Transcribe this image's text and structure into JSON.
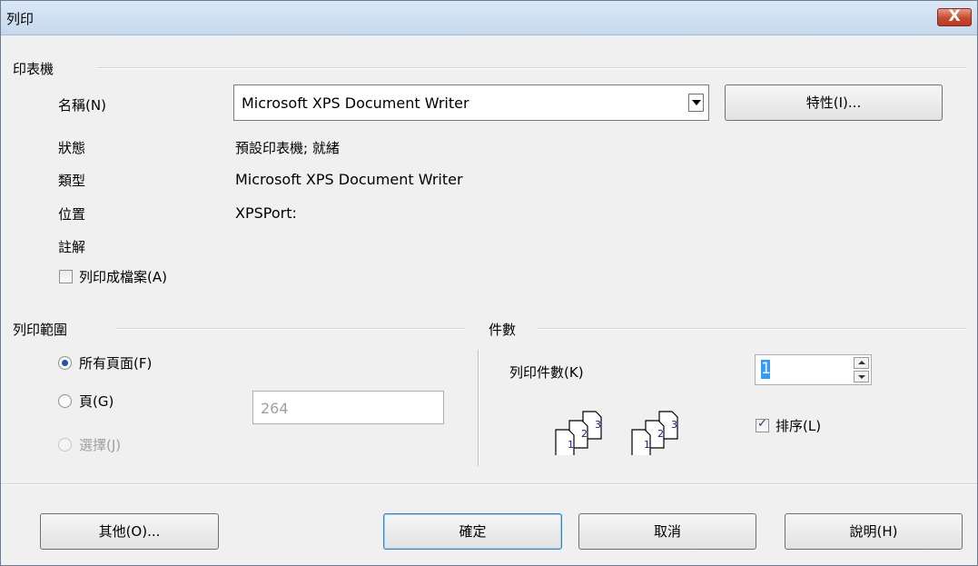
{
  "window": {
    "title": "列印",
    "close_label": "X"
  },
  "printer": {
    "group_label": "印表機",
    "name_label": "名稱(N)",
    "name_value": "Microsoft XPS Document Writer",
    "properties_button": "特性(I)...",
    "status_label": "狀態",
    "status_value": "預設印表機; 就緒",
    "type_label": "類型",
    "type_value": "Microsoft XPS Document Writer",
    "location_label": "位置",
    "location_value": "XPSPort:",
    "comment_label": "註解",
    "print_to_file_label": "列印成檔案(A)",
    "print_to_file_checked": false
  },
  "range": {
    "group_label": "列印範圍",
    "all_pages_label": "所有頁面(F)",
    "pages_label": "頁(G)",
    "pages_value": "264",
    "selection_label": "選擇(J)",
    "selected": "all"
  },
  "copies": {
    "group_label": "件數",
    "count_label": "列印件數(K)",
    "count_value": "1",
    "collate_label": "排序(L)",
    "collate_checked": true,
    "page_numbers": [
      "1",
      "2",
      "3"
    ]
  },
  "buttons": {
    "other": "其他(O)...",
    "ok": "確定",
    "cancel": "取消",
    "help": "說明(H)"
  }
}
